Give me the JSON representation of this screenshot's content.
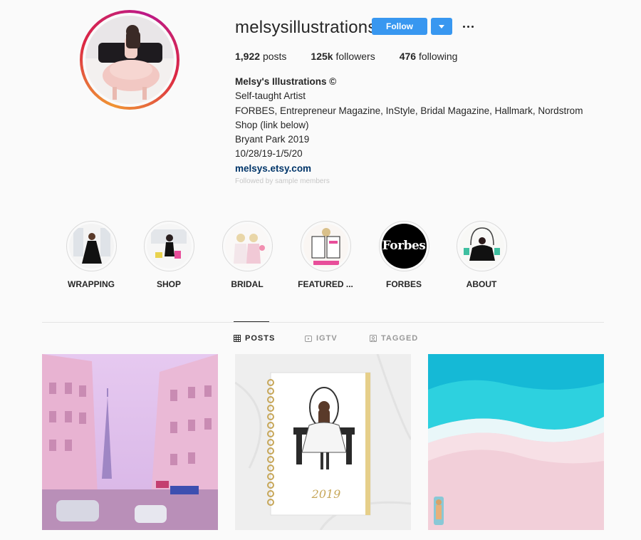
{
  "profile": {
    "username": "melsysillustrations",
    "follow_label": "Follow",
    "posts_count": "1,922",
    "posts_label": "posts",
    "followers_count": "125k",
    "followers_label": "followers",
    "following_count": "476",
    "following_label": "following",
    "bio": {
      "name": "Melsy's Illustrations ©",
      "lines": [
        "Self-taught Artist",
        "FORBES, Entrepreneur Magazine, InStyle, Bridal Magazine, Hallmark, Nordstrom",
        "Shop (link below)",
        "Bryant Park 2019",
        "10/28/19-1/5/20"
      ],
      "link": "melsys.etsy.com",
      "faded_text": "Followed by sample members"
    }
  },
  "highlights": [
    {
      "label": "WRAPPING"
    },
    {
      "label": "SHOP"
    },
    {
      "label": "BRIDAL"
    },
    {
      "label": "FEATURED ..."
    },
    {
      "label": "FORBES",
      "logo_text": "Forbes"
    },
    {
      "label": "ABOUT"
    }
  ],
  "tabs": [
    {
      "label": "POSTS",
      "icon": "grid-icon",
      "active": true
    },
    {
      "label": "IGTV",
      "icon": "igtv-icon",
      "active": false
    },
    {
      "label": "TAGGED",
      "icon": "tagged-icon",
      "active": false
    }
  ],
  "posts": [
    {
      "subject": "Paris street with Eiffel Tower in pink tones"
    },
    {
      "subject": "2019 planner with illustrated woman at vanity",
      "year_text": "2019"
    },
    {
      "subject": "Aerial beach with turquoise water and pink sand"
    }
  ],
  "colors": {
    "accent": "#3897f0",
    "link": "#003569",
    "text": "#262626",
    "muted": "#999999",
    "background": "#fafafa"
  }
}
